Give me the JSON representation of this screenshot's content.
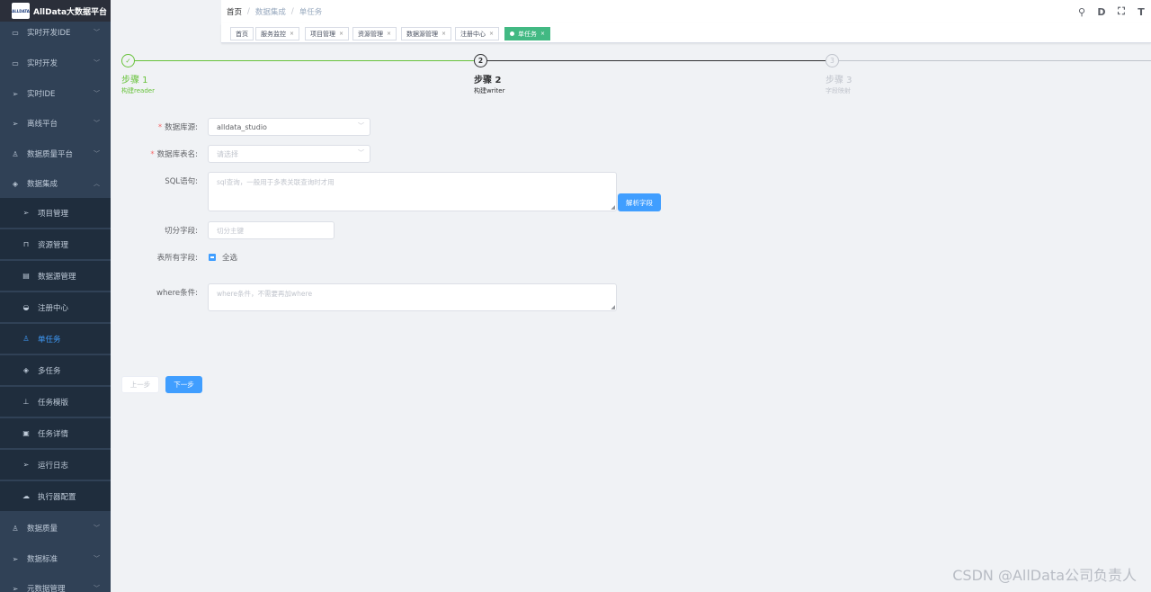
{
  "app": {
    "title": "AllData大数据平台",
    "logo_text": "ALLDATA"
  },
  "sidebar": {
    "items": [
      {
        "label": "实时开发IDE",
        "icon": "monitor-icon",
        "glyph": "▭"
      },
      {
        "label": "实时开发",
        "icon": "monitor-icon",
        "glyph": "▭"
      },
      {
        "label": "实时IDE",
        "icon": "send-icon",
        "glyph": "➢"
      },
      {
        "label": "离线平台",
        "icon": "send-icon",
        "glyph": "➢"
      },
      {
        "label": "数据质量平台",
        "icon": "user-icon",
        "glyph": "♙"
      },
      {
        "label": "数据集成",
        "icon": "cube-icon",
        "glyph": "◈"
      }
    ],
    "sub_items": [
      {
        "label": "项目管理",
        "icon": "send-icon",
        "glyph": "➢"
      },
      {
        "label": "资源管理",
        "icon": "trash-icon",
        "glyph": "⊓"
      },
      {
        "label": "数据源管理",
        "icon": "database-icon",
        "glyph": "▤"
      },
      {
        "label": "注册中心",
        "icon": "dashboard-icon",
        "glyph": "◒"
      },
      {
        "label": "单任务",
        "icon": "user-icon",
        "glyph": "♙"
      },
      {
        "label": "多任务",
        "icon": "cube-icon",
        "glyph": "◈"
      },
      {
        "label": "任务模版",
        "icon": "tree-icon",
        "glyph": "⊥"
      },
      {
        "label": "任务详情",
        "icon": "document-icon",
        "glyph": "▣"
      },
      {
        "label": "运行日志",
        "icon": "send-icon",
        "glyph": "➢"
      },
      {
        "label": "执行器配置",
        "icon": "cloud-upload-icon",
        "glyph": "☁"
      }
    ],
    "bottom_items": [
      {
        "label": "数据质量",
        "icon": "user-icon",
        "glyph": "♙"
      },
      {
        "label": "数据标准",
        "icon": "send-icon",
        "glyph": "➢"
      },
      {
        "label": "元数据管理",
        "icon": "send-icon",
        "glyph": "➢"
      }
    ]
  },
  "breadcrumb": [
    "首页",
    "数据集成",
    "单任务"
  ],
  "navbar_icons": [
    {
      "name": "search-icon",
      "glyph": "⚲"
    },
    {
      "name": "document-icon",
      "glyph": "D"
    },
    {
      "name": "fullscreen-icon",
      "glyph": "⛶"
    },
    {
      "name": "font-size-icon",
      "glyph": "T"
    }
  ],
  "tags": [
    {
      "label": "首页",
      "closable": false,
      "active": false
    },
    {
      "label": "服务监控",
      "closable": true,
      "active": false
    },
    {
      "label": "项目管理",
      "closable": true,
      "active": false
    },
    {
      "label": "资源管理",
      "closable": true,
      "active": false
    },
    {
      "label": "数据源管理",
      "closable": true,
      "active": false
    },
    {
      "label": "注册中心",
      "closable": true,
      "active": false
    },
    {
      "label": "单任务",
      "closable": true,
      "active": true
    }
  ],
  "steps": [
    {
      "number": "1",
      "title": "步骤 1",
      "description": "构建reader",
      "status": "done"
    },
    {
      "number": "2",
      "title": "步骤 2",
      "description": "构建writer",
      "status": "current"
    },
    {
      "number": "3",
      "title": "步骤 3",
      "description": "字段映射",
      "status": "wait"
    }
  ],
  "form": {
    "datasource": {
      "label": "数据库源:",
      "required": true,
      "value": "alldata_studio"
    },
    "table_name": {
      "label": "数据库表名:",
      "required": true,
      "placeholder": "请选择"
    },
    "sql": {
      "label": "SQL语句:",
      "placeholder": "sql查询，一般用于多表关联查询时才用"
    },
    "parse_button": "解析字段",
    "split_field": {
      "label": "切分字段:",
      "placeholder": "切分主键"
    },
    "all_fields": {
      "label": "表所有字段:",
      "select_all": "全选"
    },
    "where": {
      "label": "where条件:",
      "placeholder": "where条件，不需要再加where"
    }
  },
  "buttons": {
    "prev": "上一步",
    "next": "下一步"
  },
  "watermark": "CSDN @AllData公司负责人"
}
